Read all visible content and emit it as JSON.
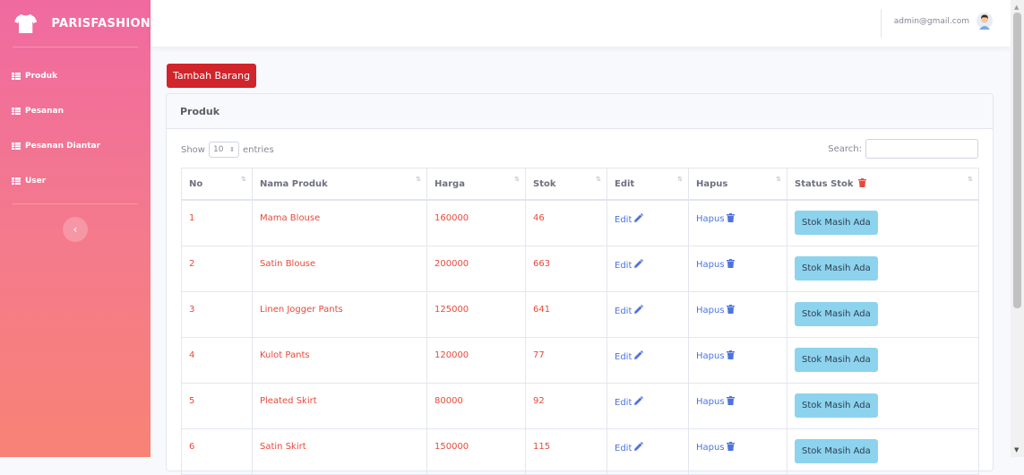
{
  "brand": {
    "name": "PARISFASHION"
  },
  "sidebar": {
    "items": [
      {
        "label": "Produk"
      },
      {
        "label": "Pesanan"
      },
      {
        "label": "Pesanan Diantar"
      },
      {
        "label": "User"
      }
    ],
    "toggle_symbol": "‹"
  },
  "topbar": {
    "user_email": "admin@gmail.com"
  },
  "actions": {
    "add_label": "Tambah Barang"
  },
  "card": {
    "title": "Produk"
  },
  "controls": {
    "show_label": "Show",
    "entries_value": "10",
    "entries_label": "entries",
    "search_label": "Search:",
    "search_value": ""
  },
  "table": {
    "sort_glyph": "⇅",
    "headers": [
      "No",
      "Nama Produk",
      "Harga",
      "Stok",
      "Edit",
      "Hapus",
      "Status Stok"
    ],
    "edit_label": "Edit",
    "hapus_label": "Hapus",
    "rows": [
      {
        "no": "1",
        "nama": "Mama Blouse",
        "harga": "160000",
        "stok": "46",
        "status": "Stok Masih Ada"
      },
      {
        "no": "2",
        "nama": "Satin Blouse",
        "harga": "200000",
        "stok": "663",
        "status": "Stok Masih Ada"
      },
      {
        "no": "3",
        "nama": "Linen Jogger Pants",
        "harga": "125000",
        "stok": "641",
        "status": "Stok Masih Ada"
      },
      {
        "no": "4",
        "nama": "Kulot Pants",
        "harga": "120000",
        "stok": "77",
        "status": "Stok Masih Ada"
      },
      {
        "no": "5",
        "nama": "Pleated Skirt",
        "harga": "80000",
        "stok": "92",
        "status": "Stok Masih Ada"
      },
      {
        "no": "6",
        "nama": "Satin Skirt",
        "harga": "150000",
        "stok": "115",
        "status": "Stok Masih Ada"
      }
    ]
  },
  "colors": {
    "sidebar_top": "#f06aa0",
    "sidebar_bottom": "#f98275",
    "danger": "#d1242b",
    "link": "#4e73df",
    "text_red": "#e74a3b",
    "status_button": "#8dd3ee"
  },
  "icons": {
    "brand": "tshirt-icon",
    "nav": "table-icon",
    "edit": "pencil-icon",
    "hapus": "trash-icon",
    "status": "trash-icon",
    "user": "avatar-icon"
  }
}
